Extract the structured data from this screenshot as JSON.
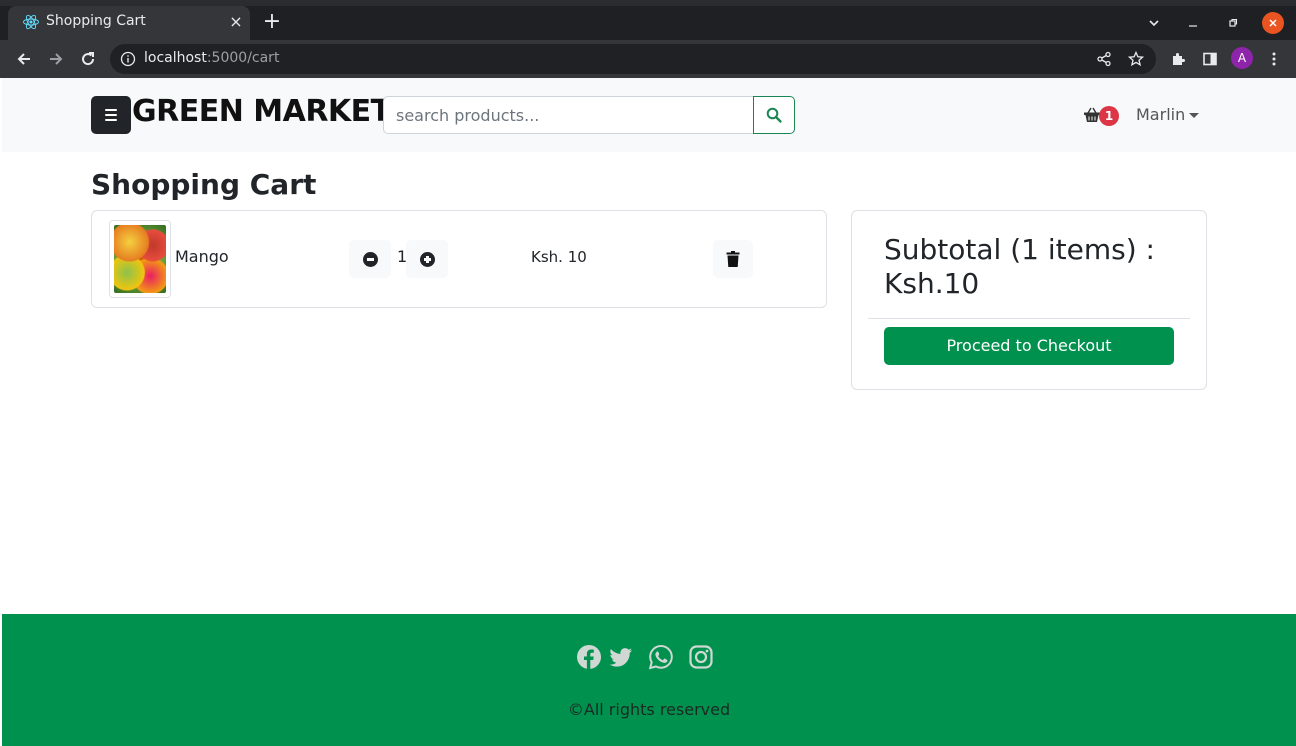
{
  "browser": {
    "tab_title": "Shopping Cart",
    "tab_close": "×",
    "new_tab": "+",
    "url_host": "localhost",
    "url_path": ":5000/cart",
    "profile_initial": "A"
  },
  "navbar": {
    "brand": "GREEN MARKET",
    "search_placeholder": "search products...",
    "cart_count": "1",
    "user_name": "Marlin"
  },
  "cart": {
    "title": "Shopping Cart",
    "items": [
      {
        "name": "Mango",
        "quantity": "1",
        "price": "Ksh. 10"
      }
    ]
  },
  "summary": {
    "subtotal_text": "Subtotal (1 items) : Ksh.10",
    "checkout_label": "Proceed to Checkout"
  },
  "footer": {
    "copyright": "©All rights reserved",
    "icons": [
      "facebook-icon",
      "twitter-icon",
      "whatsapp-icon",
      "instagram-icon"
    ]
  },
  "colors": {
    "brand_green": "#00914f",
    "badge_red": "#dc3545",
    "dark": "#212529"
  }
}
